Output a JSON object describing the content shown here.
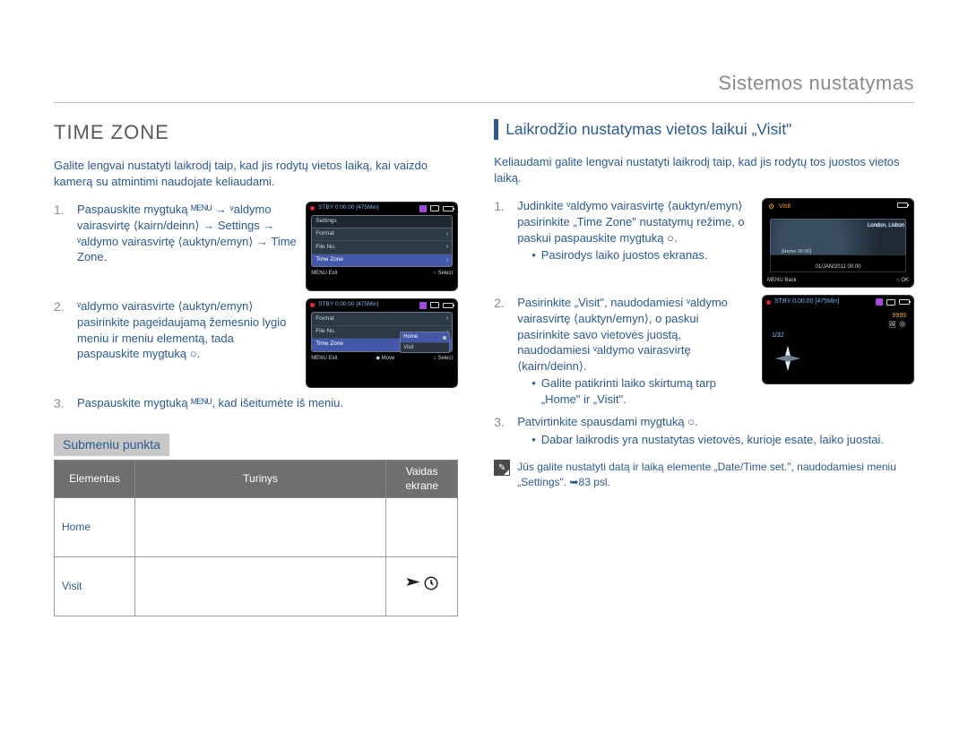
{
  "header": {
    "title": "Sistemos nustatymas"
  },
  "left": {
    "heading": "TIME ZONE",
    "intro": "Galite lengvai nustatyti laikrodį taip, kad jis rodytų vietos laiką, kai vaizdo kamerą su atmintimi naudojate keliaudami.",
    "steps": [
      "Paspauskite mygtuką ᴹᴱᴺᵁ → ᵛaldymo vairasvirtę ⟨kairn/deinn⟩ → Settings → ᵛaldymo vairasvirtę ⟨auktyn/emyn⟩ → Time Zone.",
      "ᵛaldymo vairasvirte ⟨auktyn/emyn⟩ pasirinkite pageidaujamą žemesnio lygio meniu ir meniu elementą, tada paspauskite mygtuką ○.",
      "Paspauskite mygtuką ᴹᴱᴺᵁ, kad išeitumėte iš meniu."
    ],
    "thumbs": {
      "a": {
        "top": "STBY 0:00:00 [475Min]",
        "head": "Settings",
        "items": [
          "Format",
          "File No.",
          "Time Zone"
        ],
        "bot_left": "MENU Exit",
        "bot_right": "○ Select"
      },
      "b": {
        "top": "STBY 0:00:00 [475Min]",
        "items": [
          "Format",
          "File No.",
          "Time Zone"
        ],
        "sub": [
          "Home",
          "Visit"
        ],
        "bot_left": "MENU Exit",
        "bot_mid": "◆ Move",
        "bot_right": "○ Select"
      }
    },
    "submenu_label": "Submeniu punkta",
    "table": {
      "headers": [
        "Elementas",
        "Turinys",
        "Vaidas ekrane"
      ],
      "rows": [
        {
          "name": "Home",
          "icon": ""
        },
        {
          "name": "Visit",
          "icon": "plane-clock"
        }
      ]
    }
  },
  "right": {
    "heading": "Laikrodžio nustatymas vietos laikui „Visit\"",
    "intro": "Keliaudami galite lengvai nustatyti laikrodį taip, kad jis rodytų tos juostos vietos laiką.",
    "steps": [
      {
        "text": "Judinkite ᵛaldymo vairasvirtę ⟨auktyn/emyn⟩ pasirinkite „Time Zone\" nustatymų režime, o paskui paspauskite mygtuką ○.",
        "sub": [
          "Pasirodys laiko juostos ekranas."
        ]
      },
      {
        "text": "Pasirinkite „Visit\", naudodamiesi ᵛaldymo vairasvirtę ⟨auktyn/emyn⟩, o paskui pasirinkite savo vietovės juostą, naudodamiesi ᵛaldymo vairasvirtę ⟨kairn/deinn⟩.",
        "sub": [
          "Galite patikrinti laiko skirtumą tarp „Home\" ir „Visit\"."
        ]
      },
      {
        "text": "Patvirtinkite spausdami mygtuką ○.",
        "sub": [
          "Dabar laikrodis yra nustatytas vietovės, kurioje esate, laiko juostai."
        ]
      }
    ],
    "thumbs": {
      "map": {
        "title": "Visit",
        "city": "London, Lisbon",
        "home": "[Home 00:00]",
        "date": "01/JAN/2011 00:00",
        "bot_left": "MENU Back",
        "bot_right": "○ OK"
      },
      "clock": {
        "top": "STBY 0:00:00 [475Min]",
        "counter": "9999",
        "weather": "1/32"
      }
    },
    "note": "Jūs galite nustatyti datą ir laiką elemente „Date/Time set.\", naudodamiesi meniu „Settings\".  ➥83 psl."
  },
  "pageno": "⠀⠀"
}
